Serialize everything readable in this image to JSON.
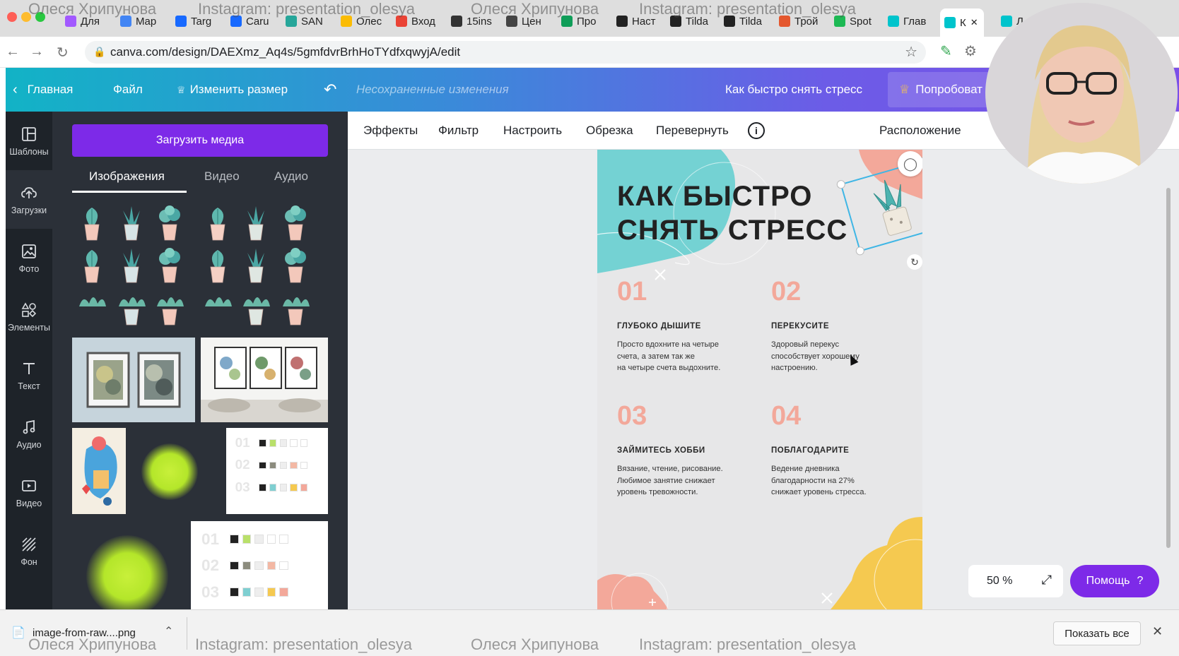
{
  "browser": {
    "watermark_name": "Олеся Хрипунова",
    "watermark_insta": "Instagram: presentation_olesya",
    "tabs": [
      {
        "label": "Для",
        "icon": "figma-icon",
        "color": "#a259ff"
      },
      {
        "label": "Map",
        "icon": "docs-icon",
        "color": "#4285f4"
      },
      {
        "label": "Targ",
        "icon": "behance-icon",
        "color": "#1769ff"
      },
      {
        "label": "Caru",
        "icon": "behance-icon",
        "color": "#1769ff"
      },
      {
        "label": "SAN",
        "icon": "bookmark-icon",
        "color": "#26a69a"
      },
      {
        "label": "Олес",
        "icon": "drive-icon",
        "color": "#fbbc04"
      },
      {
        "label": "Вход",
        "icon": "gmail-icon",
        "color": "#ea4335"
      },
      {
        "label": "15ins",
        "icon": "sticker-icon",
        "color": "#333333"
      },
      {
        "label": "Цен",
        "icon": "tag-icon",
        "color": "#444444"
      },
      {
        "label": "Про",
        "icon": "sheets-icon",
        "color": "#0f9d58"
      },
      {
        "label": "Наст",
        "icon": "tilda-icon",
        "color": "#222222"
      },
      {
        "label": "Tilda",
        "icon": "tilda-icon",
        "color": "#222222"
      },
      {
        "label": "Tilda",
        "icon": "tilda-icon",
        "color": "#222222"
      },
      {
        "label": "Трой",
        "icon": "face-icon",
        "color": "#e4572e"
      },
      {
        "label": "Spot",
        "icon": "spotify-icon",
        "color": "#1db954"
      },
      {
        "label": "Глав",
        "icon": "canva-icon",
        "color": "#00c4cc"
      },
      {
        "label": "К",
        "icon": "canva-icon",
        "color": "#00c4cc",
        "active": true
      },
      {
        "label": "Л",
        "icon": "canva-icon",
        "color": "#00c4cc"
      }
    ],
    "url": "canva.com/design/DAEXmz_Aq4s/5gmfdvrBrhHoTYdfxqwyjA/edit"
  },
  "header": {
    "home": "Главная",
    "file": "Файл",
    "resize": "Изменить размер",
    "status": "Несохраненные изменения",
    "design_title": "Как быстро снять стресс",
    "try_pro": "Попробоват"
  },
  "rail": [
    {
      "label": "Шаблоны",
      "icon": "templates-icon"
    },
    {
      "label": "Загрузки",
      "icon": "upload-cloud-icon",
      "active": true
    },
    {
      "label": "Фото",
      "icon": "photo-icon"
    },
    {
      "label": "Элементы",
      "icon": "elements-icon"
    },
    {
      "label": "Текст",
      "icon": "text-icon"
    },
    {
      "label": "Аудио",
      "icon": "music-icon"
    },
    {
      "label": "Видео",
      "icon": "video-icon"
    },
    {
      "label": "Фон",
      "icon": "background-icon"
    }
  ],
  "panel": {
    "upload_button": "Загрузить медиа",
    "tabs": [
      "Изображения",
      "Видео",
      "Аудио"
    ]
  },
  "toolbar": {
    "effects": "Эффекты",
    "filter": "Фильтр",
    "adjust": "Настроить",
    "crop": "Обрезка",
    "flip": "Перевернуть",
    "position": "Расположение"
  },
  "design": {
    "title_line1": "КАК БЫСТРО",
    "title_line2": "СНЯТЬ СТРЕСС",
    "steps": [
      {
        "num": "01",
        "heading": "ГЛУБОКО ДЫШИТЕ",
        "lines": [
          "Просто вдохните на четыре",
          "счета, а затем так же",
          "на четыре счета выдохните."
        ]
      },
      {
        "num": "02",
        "heading": "ПЕРЕКУСИТЕ",
        "lines": [
          "Здоровый перекус",
          "способствует хорошему",
          "настроению."
        ]
      },
      {
        "num": "03",
        "heading": "ЗАЙМИТЕСЬ ХОББИ",
        "lines": [
          "Вязание, чтение, рисование.",
          "Любимое занятие снижает",
          "уровень тревожности."
        ]
      },
      {
        "num": "04",
        "heading": "ПОБЛАГОДАРИТЕ",
        "lines": [
          "Ведение дневника",
          "благодарности на 27%",
          "снижает уровень стресса."
        ]
      }
    ],
    "colors": {
      "teal": "#74d2d3",
      "coral": "#f3a89a",
      "yellow": "#f5c950"
    }
  },
  "zoom": {
    "value": "50 %"
  },
  "help": {
    "label": "Помощь",
    "icon": "?"
  },
  "palette_thumbs": {
    "rows_a": [
      "01",
      "02",
      "03"
    ],
    "rows_b": [
      "01",
      "02",
      "03"
    ]
  },
  "downloads": {
    "file": "image-from-raw....png",
    "show_all": "Показать все"
  }
}
